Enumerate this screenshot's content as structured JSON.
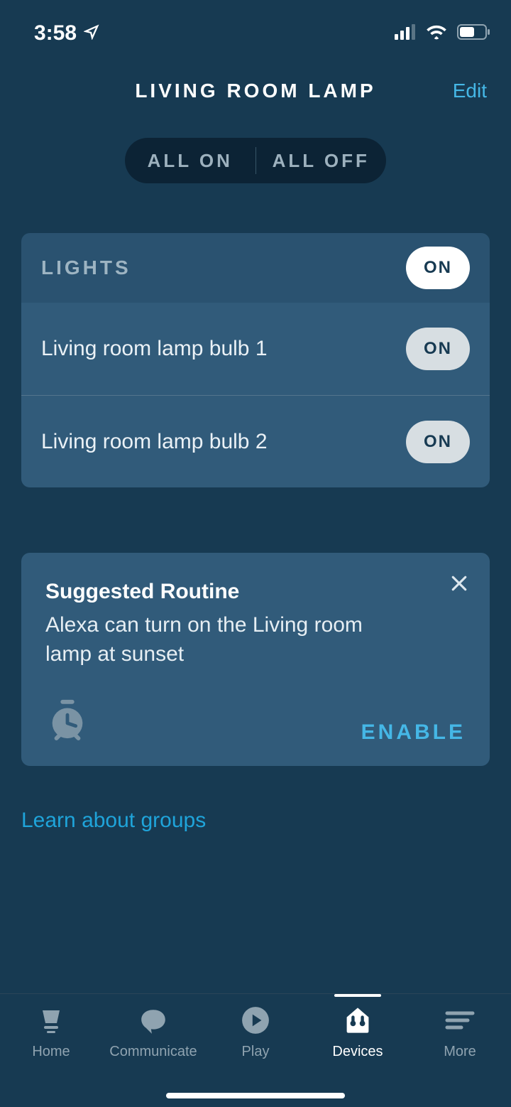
{
  "status": {
    "time": "3:58"
  },
  "header": {
    "title": "LIVING ROOM LAMP",
    "edit": "Edit"
  },
  "segment": {
    "on": "ALL ON",
    "off": "ALL OFF"
  },
  "lights": {
    "header_label": "LIGHTS",
    "header_state": "ON",
    "items": [
      {
        "name": "Living room lamp bulb 1",
        "state": "ON"
      },
      {
        "name": "Living room lamp bulb 2",
        "state": "ON"
      }
    ]
  },
  "routine": {
    "title": "Suggested Routine",
    "desc": "Alexa can turn on the Living room lamp at sunset",
    "enable": "ENABLE"
  },
  "learn_link": "Learn about groups",
  "tabs": {
    "home": "Home",
    "communicate": "Communicate",
    "play": "Play",
    "devices": "Devices",
    "more": "More"
  }
}
